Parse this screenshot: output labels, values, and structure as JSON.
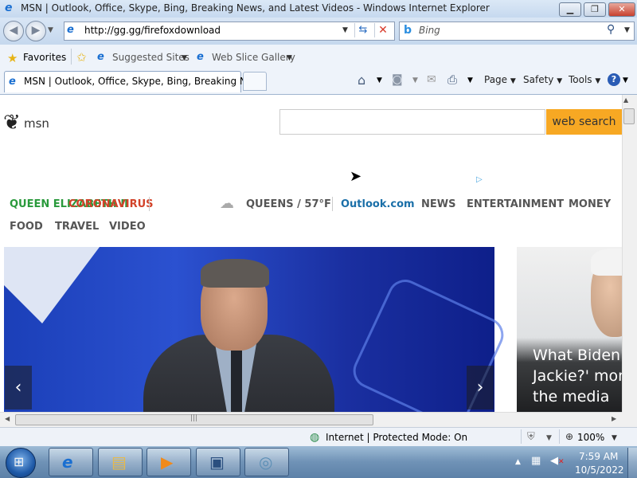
{
  "window": {
    "title": "MSN | Outlook, Office, Skype, Bing, Breaking News, and Latest Videos - Windows Internet Explorer",
    "minimize": "▁",
    "maximize": "❐",
    "close": "✕"
  },
  "address_bar": {
    "url": "http://gg.gg/firefoxdownload",
    "search_placeholder": "Bing"
  },
  "favorites_bar": {
    "favorites_label": "Favorites",
    "suggested_sites": "Suggested Sites",
    "web_slice_gallery": "Web Slice Gallery"
  },
  "tabs": [
    {
      "label": "MSN | Outlook, Office, Skype, Bing, Breaking Ne...",
      "active": true
    }
  ],
  "command_bar": {
    "page": "Page",
    "safety": "Safety",
    "tools": "Tools"
  },
  "page": {
    "logo_text": "msn",
    "search_button": "web search",
    "nav_primary": {
      "queen": "QUEEN ELIZABETH II",
      "coronavirus": "CORONAVIRUS",
      "weather": "QUEENS / 57°F",
      "outlook": "Outlook.com",
      "news": "NEWS",
      "entertainment": "ENTERTAINMENT",
      "money": "MONEY"
    },
    "nav_secondary": {
      "food": "FOOD",
      "travel": "TRAVEL",
      "video": "VIDEO"
    },
    "side_headline": "What Biden's\nJackie?' mom\nthe media"
  },
  "status_bar": {
    "zone": "Internet | Protected Mode: On",
    "zoom": "100%"
  },
  "taskbar": {
    "time": "7:59 AM",
    "date": "10/5/2022"
  },
  "icons": {
    "ie": "ie-icon",
    "star": "star-icon",
    "home": "home-icon",
    "feed": "feed-icon",
    "print": "print-icon",
    "help": "help-icon",
    "globe": "globe-icon"
  },
  "colors": {
    "search_button": "#f7a823",
    "queen_link": "#2a9a3c",
    "coronavirus_link": "#d2432a",
    "outlook_link": "#1a6fa8"
  }
}
